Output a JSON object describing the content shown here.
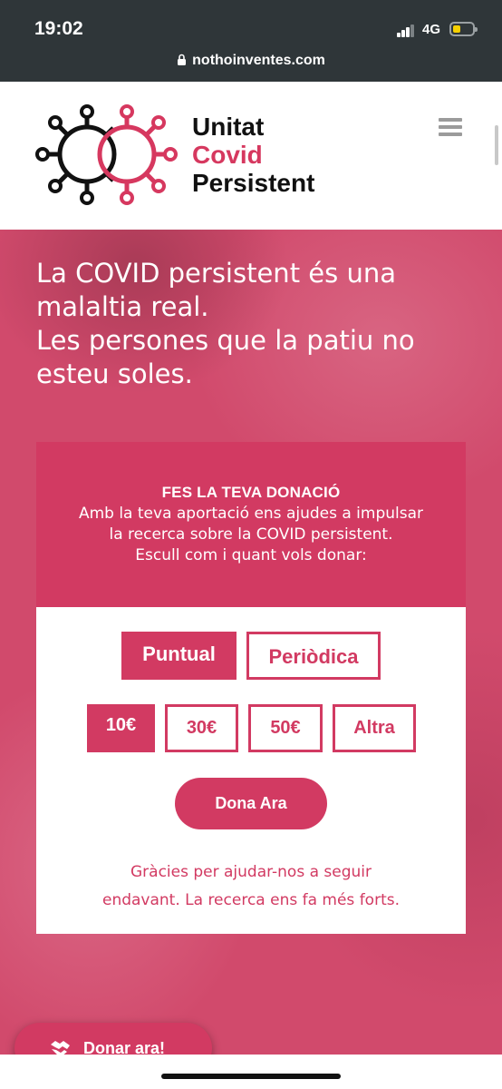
{
  "status": {
    "time": "19:02",
    "network": "4G",
    "url": "nothoinventes.com"
  },
  "brand": {
    "line1": "Unitat",
    "line2": "Covid",
    "line3": "Persistent"
  },
  "hero": {
    "line1": "La COVID persistent és una",
    "line2": "malaltia real.",
    "line3": "Les persones que la patiu no",
    "line4": "esteu soles."
  },
  "donation": {
    "title": "FES LA TEVA DONACIÓ",
    "desc1": "Amb la teva aportació ens ajudes a impulsar",
    "desc2": "la recerca sobre la COVID persistent.",
    "desc3": "Escull com i quant vols donar:",
    "types": [
      "Puntual",
      "Periòdica"
    ],
    "selected_type": "Puntual",
    "amounts": [
      "10€",
      "30€",
      "50€",
      "Altra"
    ],
    "selected_amount": "10€",
    "submit_label": "Dona Ara",
    "thanks1": "Gràcies per ajudar-nos a seguir",
    "thanks2": "endavant. La recerca ens fa més forts."
  },
  "floating": {
    "label": "Donar ara!"
  },
  "colors": {
    "accent": "#d23a62",
    "statusbar": "#2f3639",
    "text_dark": "#111111"
  },
  "icons": [
    "lock-icon",
    "signal-icon",
    "battery-icon",
    "menu-icon",
    "virus-logo-icon",
    "handshake-icon"
  ]
}
